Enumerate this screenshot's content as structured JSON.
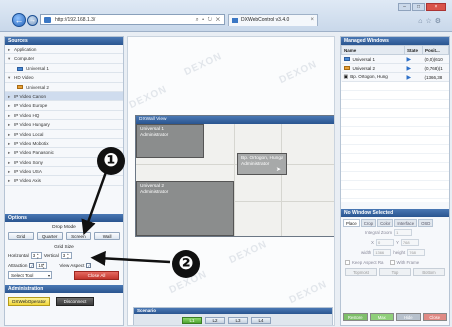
{
  "browser": {
    "address": "http://192.168.1.3/",
    "address_tools": "⌕ • ↻ ✕",
    "tab_title": "DXWebControl v3.4.0"
  },
  "sources": {
    "header": "Sources",
    "items": [
      {
        "label": "Application",
        "expander": "▸",
        "icon": ""
      },
      {
        "label": "Computer",
        "expander": "▾",
        "icon": ""
      },
      {
        "label": "Universal 1",
        "expander": "",
        "icon": "monitor-icon"
      },
      {
        "label": "HD Video",
        "expander": "▾",
        "icon": ""
      },
      {
        "label": "Universal 2",
        "expander": "",
        "icon": "hd-icon"
      },
      {
        "label": "IP Video Canon",
        "expander": "▸",
        "icon": ""
      },
      {
        "label": "IP Video Europe",
        "expander": "▸",
        "icon": ""
      },
      {
        "label": "IP Video HQ",
        "expander": "▸",
        "icon": ""
      },
      {
        "label": "IP Video Hungary",
        "expander": "▸",
        "icon": ""
      },
      {
        "label": "IP Video Local",
        "expander": "▸",
        "icon": ""
      },
      {
        "label": "IP Video Mobotix",
        "expander": "▸",
        "icon": ""
      },
      {
        "label": "IP Video Panasonic",
        "expander": "▸",
        "icon": ""
      },
      {
        "label": "IP Video Sony",
        "expander": "▸",
        "icon": ""
      },
      {
        "label": "IP Video USA",
        "expander": "▸",
        "icon": ""
      },
      {
        "label": "IP Video Axis",
        "expander": "▸",
        "icon": ""
      }
    ]
  },
  "options": {
    "header": "Options",
    "drop_mode_label": "Drop Mode",
    "drop_buttons": [
      "Grid",
      "Quarter",
      "Screen",
      "Wall"
    ],
    "grid_size_label": "Grid Size",
    "horizontal_label": "Horizontal",
    "horizontal_value": "3",
    "vertical_label": "Vertical",
    "vertical_value": "3",
    "attraction_label": "Attraction",
    "attraction_value": "10",
    "view_aspect_label": "View Aspect",
    "select_placeholder": "Select Tool",
    "close_all": "Close All"
  },
  "administration": {
    "header": "Administration",
    "operator_button": "DXWebOperator",
    "disconnect_button": "Disconnect"
  },
  "wall": {
    "header": "DXWall View",
    "windows": [
      {
        "title": "Universal 1",
        "subtitle": "Administrator"
      },
      {
        "title": "Bp. Ortogon, Hungary",
        "subtitle": "Administrator"
      },
      {
        "title": "Universal 2",
        "subtitle": "Administrator"
      }
    ]
  },
  "watermark": "DEXON",
  "scenario": {
    "header": "Scenario",
    "buttons": [
      "L1",
      "L2",
      "L3",
      "L4"
    ]
  },
  "managed": {
    "header": "Managed Windows",
    "columns": [
      "Name",
      "State",
      "Posit..."
    ],
    "rows": [
      {
        "name": "Universal 1",
        "icon": "monitor-icon",
        "position": "(0,0)(610"
      },
      {
        "name": "Universal 2",
        "icon": "hd-icon",
        "position": "(0,768)(1"
      },
      {
        "name": "Bp. Ortogon, Hung",
        "icon": "camera-icon",
        "position": "(1366,38"
      }
    ]
  },
  "no_window": {
    "header": "No Window Selected",
    "tabs": [
      "Place",
      "Crop",
      "Color",
      "Interface",
      "OSD"
    ],
    "integral_zoom_label": "Integral Zoom",
    "integral_zoom_value": "1",
    "x_label": "X",
    "x_value": "0",
    "y_label": "Y",
    "y_value": "768",
    "width_label": "width",
    "width_value": "1366",
    "height_label": "height",
    "height_value": "768",
    "keep_aspect_label": "Keep Aspect Ra",
    "with_frame_label": "With Frame",
    "buttons": [
      "Topmost",
      "Top",
      "Bottom"
    ],
    "bottom_buttons": [
      {
        "label": "Restore",
        "color": "#7fbf6a"
      },
      {
        "label": "Max",
        "color": "#8fcf7a"
      },
      {
        "label": "Hide",
        "color": "#b7c1cc"
      },
      {
        "label": "Close",
        "color": "#e08a84"
      }
    ]
  },
  "annotations": [
    "❶",
    "❷"
  ]
}
